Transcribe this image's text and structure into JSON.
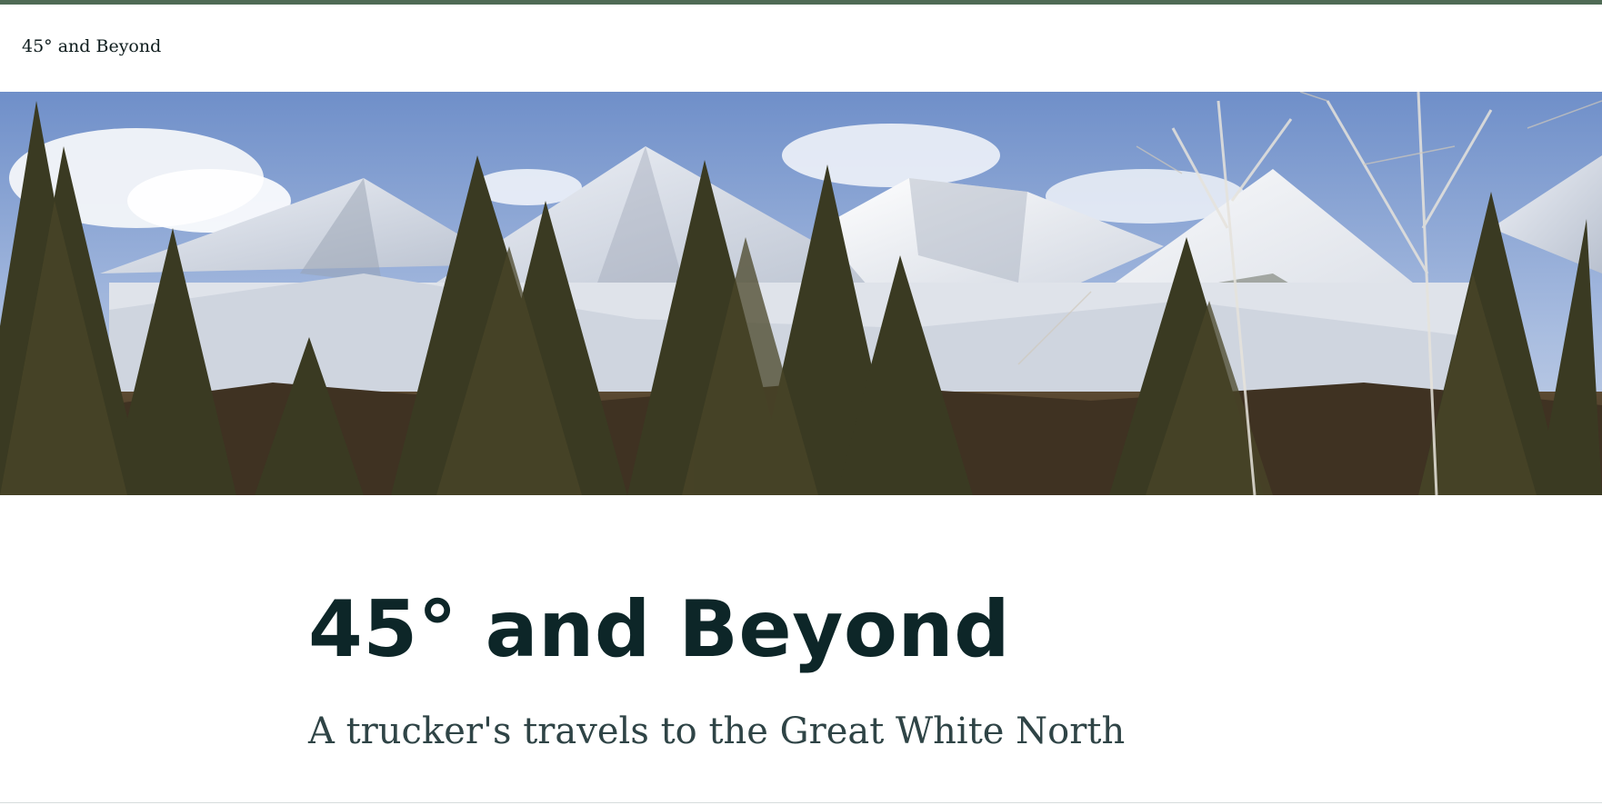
{
  "header": {
    "site_title": "45° and Beyond"
  },
  "hero": {
    "image_icon": "mountain-landscape-banner"
  },
  "intro": {
    "title": "45° and Beyond",
    "tagline": "A trucker's travels to the Great White North"
  },
  "colors": {
    "accent_bar": "#4f6b55",
    "title_text": "#0d2628",
    "tagline_text": "#2f4446",
    "background": "#ffffff"
  }
}
